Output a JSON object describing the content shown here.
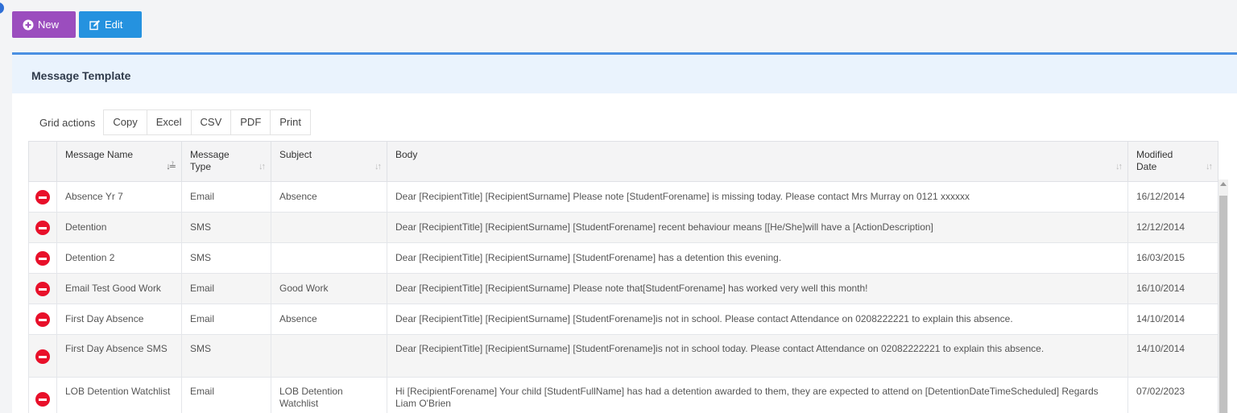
{
  "toolbar": {
    "new_label": "New",
    "edit_label": "Edit"
  },
  "panel": {
    "title": "Message Template"
  },
  "grid_actions": {
    "label": "Grid actions",
    "copy": "Copy",
    "excel": "Excel",
    "csv": "CSV",
    "pdf": "PDF",
    "print": "Print"
  },
  "table": {
    "headers": {
      "message_name": "Message Name",
      "message_type": "Message Type",
      "subject": "Subject",
      "body": "Body",
      "modified_date": "Modified Date"
    },
    "rows": [
      {
        "name": "Absence Yr 7",
        "type": "Email",
        "subject": "Absence",
        "body": "Dear [RecipientTitle] [RecipientSurname] Please note [StudentForename] is missing today. Please contact Mrs Murray on 0121 xxxxxx",
        "date": "16/12/2014"
      },
      {
        "name": "Detention",
        "type": "SMS",
        "subject": "",
        "body": "Dear [RecipientTitle] [RecipientSurname] [StudentForename] recent behaviour means [[He/She]will have a [ActionDescription]",
        "date": "12/12/2014"
      },
      {
        "name": "Detention 2",
        "type": "SMS",
        "subject": "",
        "body": "Dear [RecipientTitle] [RecipientSurname] [StudentForename] has a detention this evening.",
        "date": "16/03/2015"
      },
      {
        "name": "Email Test Good Work",
        "type": "Email",
        "subject": "Good Work",
        "body": "Dear [RecipientTitle] [RecipientSurname] Please note that[StudentForename] has worked very well this month!",
        "date": "16/10/2014"
      },
      {
        "name": "First Day Absence",
        "type": "Email",
        "subject": "Absence",
        "body": "Dear [RecipientTitle] [RecipientSurname] [StudentForename]is not in school. Please contact Attendance on 0208222221 to explain this absence.",
        "date": "14/10/2014"
      },
      {
        "name": "First Day Absence SMS",
        "type": "SMS",
        "subject": "",
        "body": "Dear [RecipientTitle] [RecipientSurname] [StudentForename]is not in school today. Please contact Attendance on 02082222221 to explain this absence.",
        "date": "14/10/2014"
      },
      {
        "name": "LOB Detention Watchlist",
        "type": "Email",
        "subject": "LOB Detention Watchlist",
        "body": "Hi [RecipientForename] Your child [StudentFullName] has had a detention awarded to them, they are expected to attend on [DetentionDateTimeScheduled] Regards Liam O'Brien",
        "date": "07/02/2023"
      }
    ]
  },
  "colors": {
    "new_button": "#9b4dbe",
    "edit_button": "#2592df",
    "accent": "#4a90e2",
    "delete": "#e8102a"
  }
}
